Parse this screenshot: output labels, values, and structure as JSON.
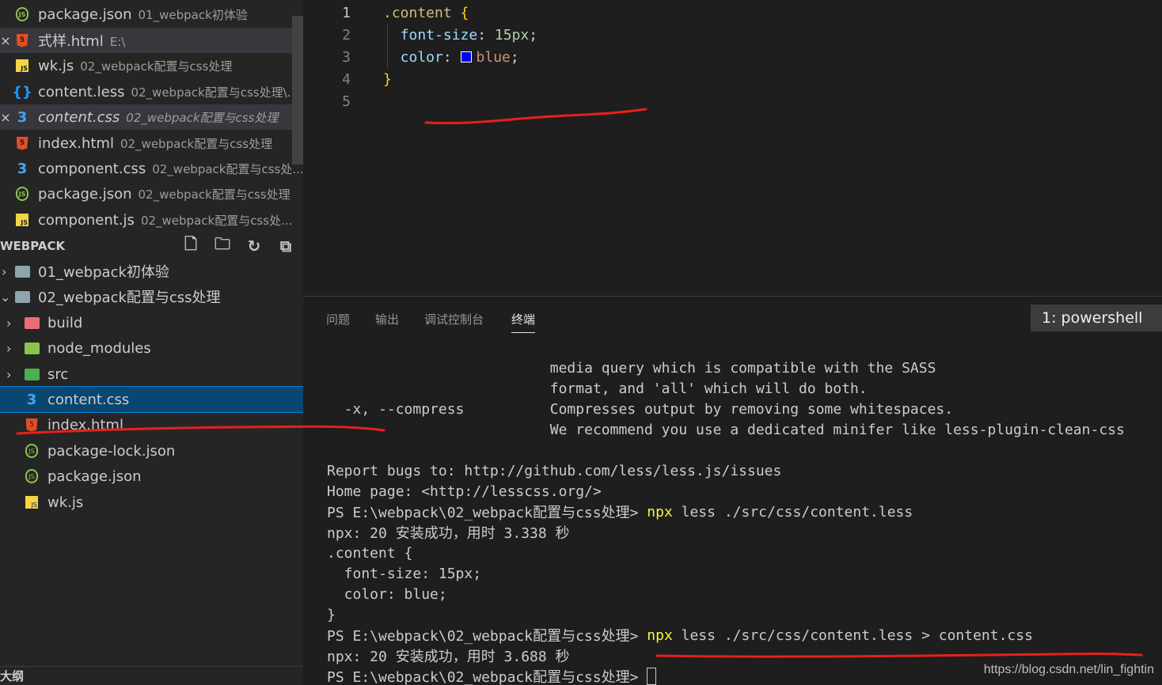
{
  "open_editors": [
    {
      "name": "package.json",
      "desc": "01_webpack初体验",
      "icon": "nodejs-icon",
      "close": false,
      "active": false,
      "italic": false
    },
    {
      "name": "式样.html",
      "desc": "E:\\",
      "icon": "html-icon",
      "close": true,
      "active": true,
      "italic": false
    },
    {
      "name": "wk.js",
      "desc": "02_webpack配置与css处理",
      "icon": "js-icon",
      "close": false,
      "active": false,
      "italic": false
    },
    {
      "name": "content.less",
      "desc": "02_webpack配置与css处理\\...",
      "icon": "less-icon",
      "close": false,
      "active": false,
      "italic": false
    },
    {
      "name": "content.css",
      "desc": "02_webpack配置与css处理",
      "icon": "css-icon",
      "close": true,
      "active": true,
      "italic": true
    },
    {
      "name": "index.html",
      "desc": "02_webpack配置与css处理",
      "icon": "html-icon",
      "close": false,
      "active": false,
      "italic": false
    },
    {
      "name": "component.css",
      "desc": "02_webpack配置与css处...",
      "icon": "css-icon",
      "close": false,
      "active": false,
      "italic": false
    },
    {
      "name": "package.json",
      "desc": "02_webpack配置与css处理",
      "icon": "nodejs-icon",
      "close": false,
      "active": false,
      "italic": false
    },
    {
      "name": "component.js",
      "desc": "02_webpack配置与css处...",
      "icon": "js-icon",
      "close": false,
      "active": false,
      "italic": false
    }
  ],
  "explorer": {
    "section_title": "WEBPACK",
    "close_glyph": "×",
    "tree": [
      {
        "name": "01_webpack初体验",
        "type": "folder",
        "color": "gray",
        "chevron": "›",
        "depth": 0
      },
      {
        "name": "02_webpack配置与css处理",
        "type": "folder-open",
        "color": "gray",
        "chevron": "⌄",
        "depth": 0
      },
      {
        "name": "build",
        "type": "folder",
        "color": "red",
        "chevron": "›",
        "depth": 1
      },
      {
        "name": "node_modules",
        "type": "folder",
        "color": "green",
        "chevron": "›",
        "depth": 1
      },
      {
        "name": "src",
        "type": "folder",
        "color": "src",
        "chevron": "›",
        "depth": 1
      },
      {
        "name": "content.css",
        "type": "css",
        "selected": true,
        "depth": 1
      },
      {
        "name": "index.html",
        "type": "html",
        "depth": 1
      },
      {
        "name": "package-lock.json",
        "type": "json",
        "depth": 1
      },
      {
        "name": "package.json",
        "type": "json",
        "depth": 1
      },
      {
        "name": "wk.js",
        "type": "js",
        "depth": 1
      }
    ],
    "outline_title": "大纲"
  },
  "editor": {
    "line_numbers": [
      "1",
      "2",
      "3",
      "4",
      "5"
    ],
    "code": {
      "l1_selector": ".content",
      "l1_brace": " {",
      "l2_prop": "  font-size",
      "l2_colon": ": ",
      "l2_value": "15px",
      "l2_semi": ";",
      "l3_prop": "  color",
      "l3_colon": ": ",
      "l3_value": "blue",
      "l3_semi": ";",
      "l4_brace": "}"
    },
    "swatch_color": "#0000ff"
  },
  "panel": {
    "tabs": [
      "问题",
      "输出",
      "调试控制台",
      "终端"
    ],
    "active_tab": "终端",
    "terminal_select": "1: powershell",
    "lines": [
      "                          media query which is compatible with the SASS",
      "                          format, and 'all' which will do both.",
      "  -x, --compress          Compresses output by removing some whitespaces.",
      "                          We recommend you use a dedicated minifer like less-plugin-clean-css",
      "",
      "Report bugs to: http://github.com/less/less.js/issues",
      "Home page: <http://lesscss.org/>"
    ],
    "prompt": "PS E:\\webpack\\02_webpack配置与css处理> ",
    "cmd1_hl": "npx",
    "cmd1_rest": " less ./src/css/content.less",
    "npx_line1": "npx: 20 安装成功，用时 3.338 秒",
    "output": [
      ".content {",
      "  font-size: 15px;",
      "  color: blue;",
      "}"
    ],
    "cmd2_hl": "npx",
    "cmd2_rest": " less ./src/css/content.less > content.css",
    "npx_line2": "npx: 20 安装成功，用时 3.688 秒"
  },
  "watermark": "https://blog.csdn.net/lin_fightin",
  "annotation_color": "#e8201c"
}
